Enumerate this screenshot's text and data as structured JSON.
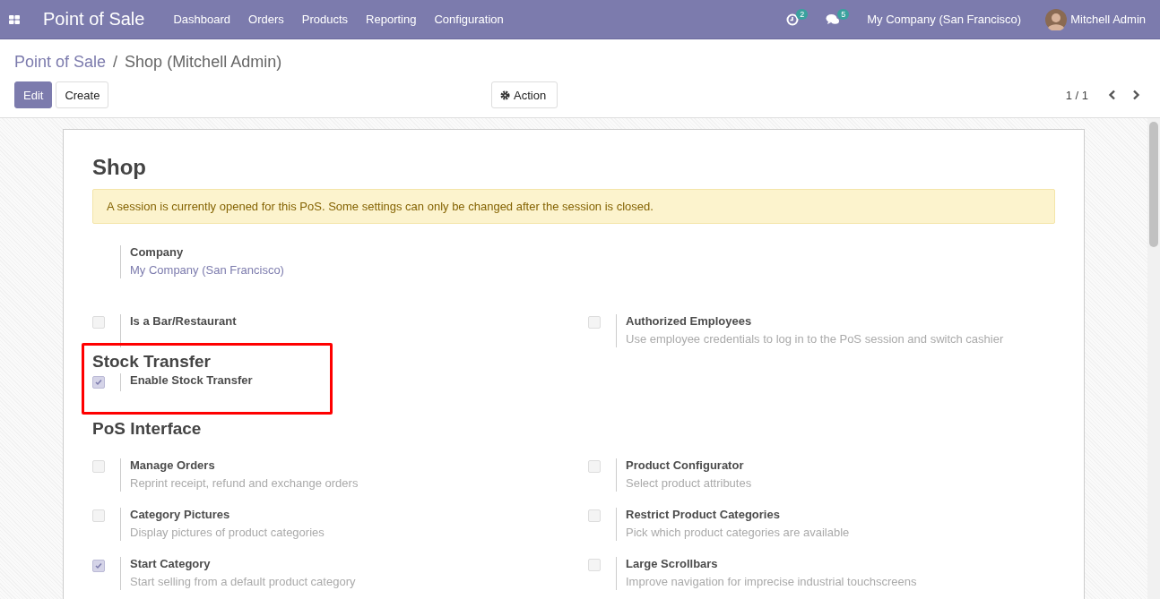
{
  "navbar": {
    "app_title": "Point of Sale",
    "menu": [
      "Dashboard",
      "Orders",
      "Products",
      "Reporting",
      "Configuration"
    ],
    "activity_count": "2",
    "message_count": "5",
    "company": "My Company (San Francisco)",
    "user": "Mitchell Admin"
  },
  "breadcrumb": {
    "parent": "Point of Sale",
    "separator": "/",
    "current": "Shop (Mitchell Admin)"
  },
  "buttons": {
    "edit": "Edit",
    "create": "Create",
    "action": "Action"
  },
  "pager": "1 / 1",
  "sheet": {
    "title": "Shop",
    "alert": "A session is currently opened for this PoS. Some settings can only be changed after the session is closed.",
    "sections": [
      {
        "settings": [
          {
            "kind": "field",
            "label": "Company",
            "value": "My Company (San Francisco)"
          },
          {
            "kind": "spacer"
          },
          {
            "kind": "checkbox",
            "label": "Is a Bar/Restaurant",
            "checked": false
          },
          {
            "kind": "checkbox",
            "label": "Authorized Employees",
            "description": "Use employee credentials to log in to the PoS session and switch cashier",
            "checked": false
          }
        ]
      },
      {
        "title": "Stock Transfer",
        "highlighted": true,
        "settings": [
          {
            "kind": "checkbox",
            "label": "Enable Stock Transfer",
            "checked": true
          }
        ]
      },
      {
        "title": "PoS Interface",
        "settings": [
          {
            "kind": "checkbox",
            "label": "Manage Orders",
            "description": "Reprint receipt, refund and exchange orders",
            "checked": false
          },
          {
            "kind": "checkbox",
            "label": "Product Configurator",
            "description": "Select product attributes",
            "checked": false
          },
          {
            "kind": "checkbox",
            "label": "Category Pictures",
            "description": "Display pictures of product categories",
            "checked": false
          },
          {
            "kind": "checkbox",
            "label": "Restrict Product Categories",
            "description": "Pick which product categories are available",
            "checked": false
          },
          {
            "kind": "checkbox",
            "label": "Start Category",
            "description": "Start selling from a default product category",
            "checked": true
          },
          {
            "kind": "checkbox",
            "label": "Large Scrollbars",
            "description": "Improve navigation for imprecise industrial touchscreens",
            "checked": false
          }
        ]
      }
    ]
  }
}
